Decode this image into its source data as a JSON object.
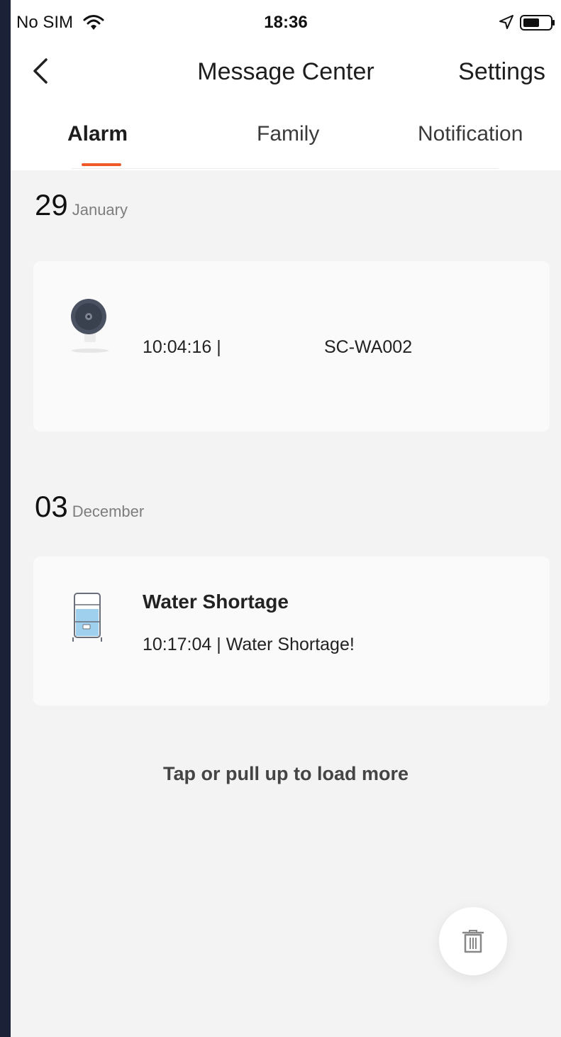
{
  "status_bar": {
    "carrier": "No SIM",
    "time": "18:36",
    "icons": [
      "wifi-icon",
      "location-arrow-icon",
      "battery-icon"
    ]
  },
  "nav": {
    "back_icon": "chevron-left-icon",
    "title": "Message Center",
    "settings": "Settings"
  },
  "tabs": [
    {
      "label": "Alarm",
      "active": true
    },
    {
      "label": "Family",
      "active": false
    },
    {
      "label": "Notification",
      "active": false
    }
  ],
  "groups": [
    {
      "day": "29",
      "month": "January",
      "messages": [
        {
          "icon": "camera-icon",
          "time": "10:04:16 |",
          "device": "SC-WA002"
        }
      ]
    },
    {
      "day": "03",
      "month": "December",
      "messages": [
        {
          "icon": "water-tank-icon",
          "title": "Water Shortage",
          "detail": "10:17:04 | Water Shortage!"
        }
      ]
    }
  ],
  "load_more": "Tap or pull up to load more",
  "delete_icon": "trash-icon",
  "colors": {
    "accent": "#f05a28",
    "page_bg": "#f3f3f3",
    "frame_bg": "#1b2136"
  }
}
